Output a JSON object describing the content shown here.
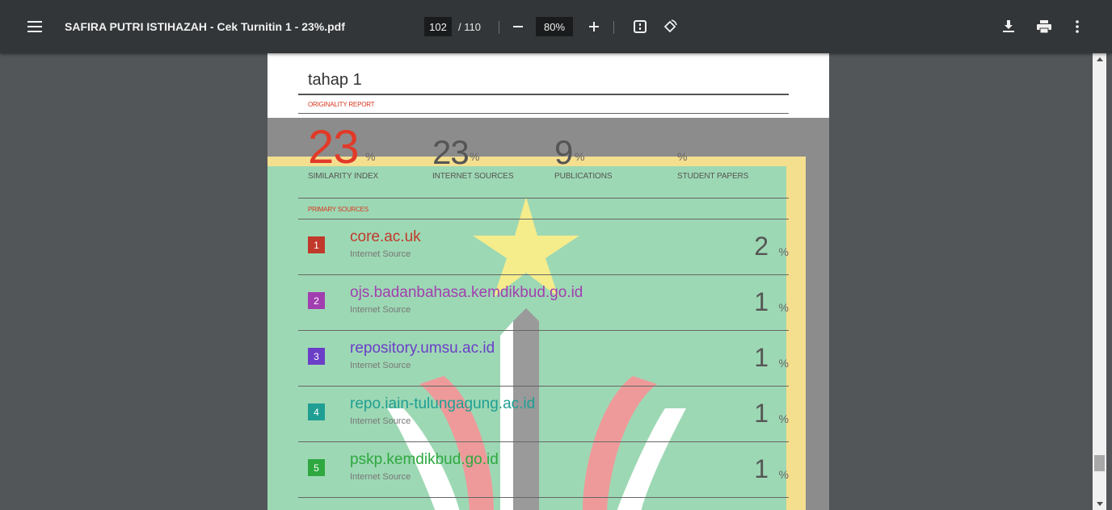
{
  "toolbar": {
    "title": "SAFIRA PUTRI ISTIHAZAH - Cek Turnitin 1 - 23%.pdf",
    "page_current": "102",
    "page_total": "/ 110",
    "zoom": "80%",
    "icons": [
      "menu-icon",
      "zoom-out-icon",
      "zoom-in-icon",
      "fit-page-icon",
      "rotate-icon",
      "download-icon",
      "print-icon",
      "more-icon"
    ]
  },
  "report": {
    "doc_title": "tahap 1",
    "originality_heading": "ORIGINALITY REPORT",
    "stats": [
      {
        "value": "23",
        "pct": "%",
        "label": "SIMILARITY INDEX"
      },
      {
        "value": "23",
        "pct": "%",
        "label": "INTERNET SOURCES"
      },
      {
        "value": "9",
        "pct": "%",
        "label": "PUBLICATIONS"
      },
      {
        "value": "",
        "pct": "%",
        "label": "STUDENT PAPERS"
      }
    ],
    "primary_heading": "PRIMARY SOURCES",
    "sources": [
      {
        "num": "1",
        "name": "core.ac.uk",
        "type": "Internet Source",
        "pct": "2",
        "sign": "%",
        "color": "#c0392b"
      },
      {
        "num": "2",
        "name": "ojs.badanbahasa.kemdikbud.go.id",
        "type": "Internet Source",
        "pct": "1",
        "sign": "%",
        "color": "#a23fb0"
      },
      {
        "num": "3",
        "name": "repository.umsu.ac.id",
        "type": "Internet Source",
        "pct": "1",
        "sign": "%",
        "color": "#6b3ec8"
      },
      {
        "num": "4",
        "name": "repo.iain-tulungagung.ac.id",
        "type": "Internet Source",
        "pct": "1",
        "sign": "%",
        "color": "#1f9f93"
      },
      {
        "num": "5",
        "name": "pskp.kemdikbud.go.id",
        "type": "Internet Source",
        "pct": "1",
        "sign": "%",
        "color": "#2ea83f"
      }
    ]
  },
  "colors": {
    "toolbar_bg": "#323639",
    "viewer_bg": "#525659",
    "accent_red": "#e13a28",
    "watermark_green": "#9dd8b4",
    "watermark_yellow": "#f4df8f"
  }
}
